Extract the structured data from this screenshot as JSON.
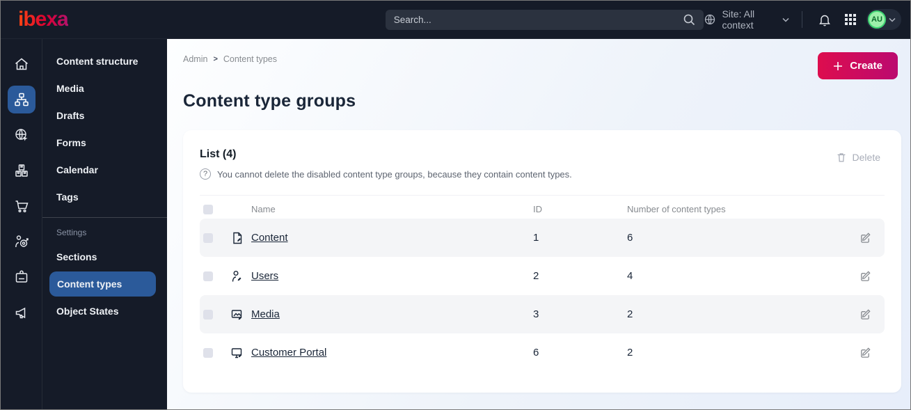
{
  "colors": {
    "topbar-bg": "#151b28",
    "active-blue": "#2b5a9a",
    "brand-start": "#ff4713",
    "brand-mid": "#db0032",
    "brand-end": "#b5136d",
    "create-start": "#dd0d4e",
    "create-end": "#bb0a6f",
    "avatar-bg": "#9df0ab",
    "avatar-text": "#0b6b2d"
  },
  "topbar": {
    "logo": "ibexa",
    "search_placeholder": "Search...",
    "site_context": "Site: All context",
    "avatar_initials": "AU"
  },
  "sidebar": {
    "icon_rail": [
      "home",
      "content-structure",
      "site",
      "products",
      "commerce",
      "personalization",
      "admin",
      "campaigns"
    ],
    "menu": {
      "items": [
        "Content structure",
        "Media",
        "Drafts",
        "Forms",
        "Calendar",
        "Tags"
      ],
      "settings_label": "Settings",
      "settings_items": [
        "Sections",
        "Content types",
        "Object States"
      ],
      "active_item": "Content types"
    }
  },
  "main": {
    "breadcrumb": {
      "items": [
        "Admin",
        "Content types"
      ],
      "separator": ">"
    },
    "create_label": "Create",
    "title": "Content type groups",
    "list": {
      "title": "List (4)",
      "help_icon_glyph": "?",
      "info": "You cannot delete the disabled content type groups, because they contain content types.",
      "delete_label": "Delete",
      "table": {
        "columns": [
          "Name",
          "ID",
          "Number of content types"
        ],
        "rows": [
          {
            "icon": "content-file",
            "name": "Content",
            "id": "1",
            "count": "6"
          },
          {
            "icon": "users-person",
            "name": "Users",
            "id": "2",
            "count": "4"
          },
          {
            "icon": "media-image",
            "name": "Media",
            "id": "3",
            "count": "2"
          },
          {
            "icon": "customer-portal-monitor",
            "name": "Customer Portal",
            "id": "6",
            "count": "2"
          }
        ]
      }
    }
  }
}
